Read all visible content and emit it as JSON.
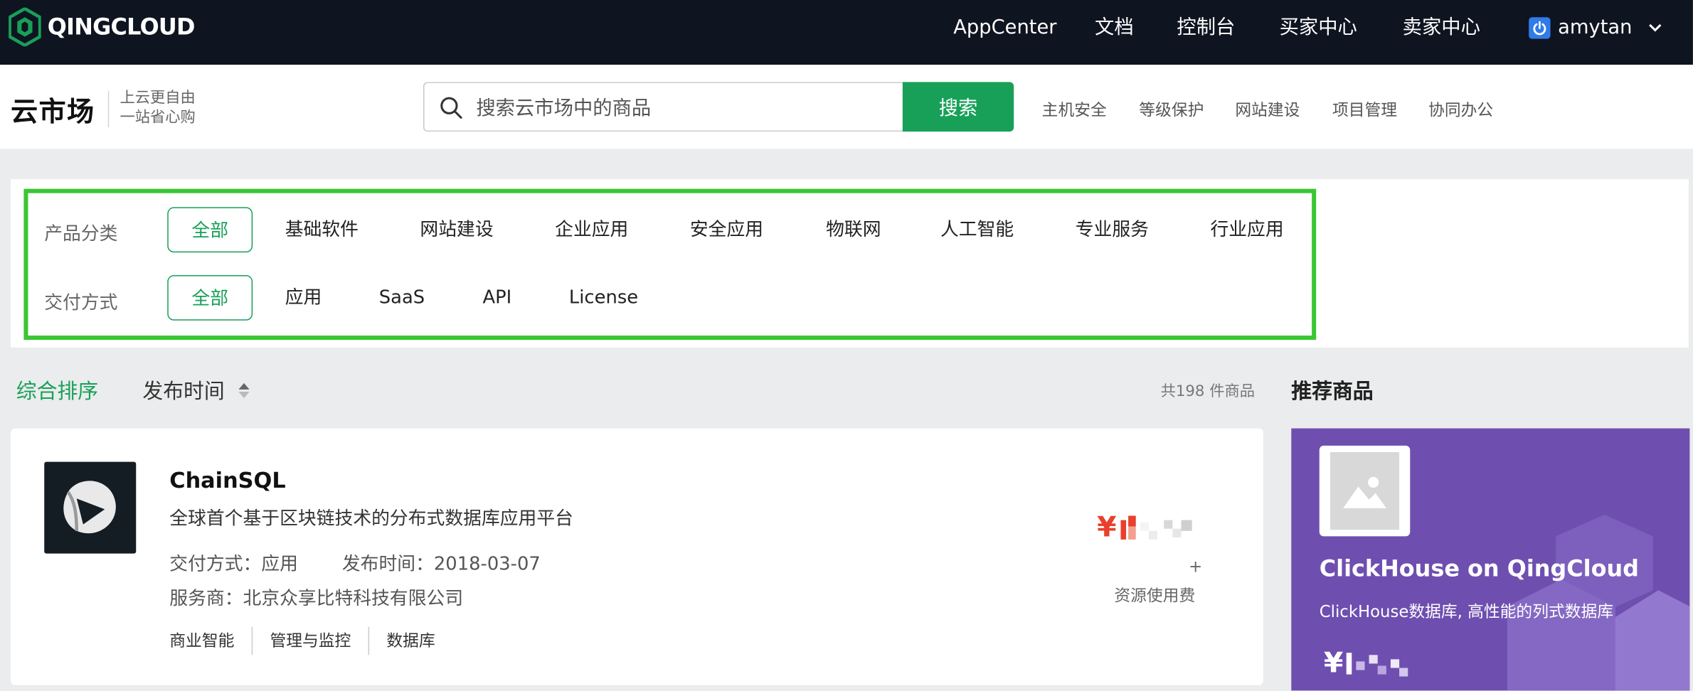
{
  "brand": {
    "name": "QINGCLOUD"
  },
  "topnav": {
    "links": [
      "AppCenter",
      "文档",
      "控制台",
      "买家中心",
      "卖家中心"
    ],
    "user": "amytan"
  },
  "header": {
    "title": "云市场",
    "slogan_line1": "上云更自由",
    "slogan_line2": "一站省心购",
    "search_placeholder": "搜索云市场中的商品",
    "search_button": "搜索",
    "quick_links": [
      "主机安全",
      "等级保护",
      "网站建设",
      "项目管理",
      "协同办公"
    ]
  },
  "filters": {
    "category": {
      "label": "产品分类",
      "options": [
        "全部",
        "基础软件",
        "网站建设",
        "企业应用",
        "安全应用",
        "物联网",
        "人工智能",
        "专业服务",
        "行业应用"
      ],
      "selected": "全部"
    },
    "delivery": {
      "label": "交付方式",
      "options": [
        "全部",
        "应用",
        "SaaS",
        "API",
        "License"
      ],
      "selected": "全部"
    }
  },
  "sort": {
    "default_label": "综合排序",
    "time_label": "发布时间",
    "count_text": "共198 件商品"
  },
  "product": {
    "name": "ChainSQL",
    "description": "全球首个基于区块链技术的分布式数据库应用平台",
    "delivery_label": "交付方式：",
    "delivery": "应用",
    "release_label": "发布时间：",
    "release_date": "2018-03-07",
    "vendor_label": "服务商：",
    "vendor": "北京众享比特科技有限公司",
    "tags": [
      "商业智能",
      "管理与监控",
      "数据库"
    ],
    "price_symbol": "¥",
    "price_plus": "+",
    "fee_label": "资源使用费"
  },
  "recommended": {
    "title": "推荐商品",
    "name": "ClickHouse on QingCloud",
    "description": "ClickHouse数据库, 高性能的列式数据库",
    "price_symbol": "¥"
  },
  "colors": {
    "nav_bg": "#0f1421",
    "accent_green": "#18a058",
    "highlight_border": "#3bc633",
    "price_red": "#e8402c",
    "rec_purple": "#6e4fb0"
  }
}
